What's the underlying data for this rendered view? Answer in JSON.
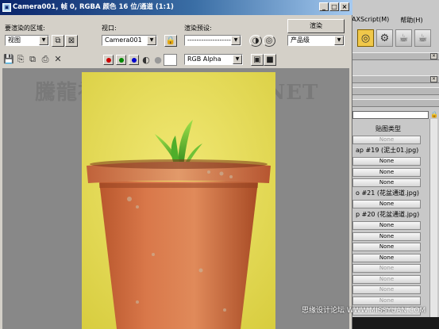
{
  "window": {
    "title": "Camera001, 帧 0, RGBA 颜色 16 位/通道 (1:1)",
    "title_icon": "render-frame-icon",
    "controls": {
      "minimize": "_",
      "maximize": "□",
      "close": "×"
    }
  },
  "toolbar": {
    "area_label": "要渲染的区域:",
    "area_value": "视图",
    "viewport_label": "视口:",
    "viewport_value": "Camera001",
    "preset_label": "渲染预设:",
    "preset_value": "-------------------",
    "render_button": "渲染",
    "mode_value": "产品级",
    "channel_value": "RGB Alpha"
  },
  "channels": {
    "red": "#cc0000",
    "green": "#008800",
    "blue": "#0000cc"
  },
  "viewport": {
    "watermark": "騰龍視覺WWW.TLV1.NET",
    "background": "#888888"
  },
  "background_app": {
    "menu": [
      "AXScript(M)",
      "帮助(H)"
    ],
    "panel_header": "贴图类型",
    "rows": [
      {
        "text": "None",
        "kind": "dim"
      },
      {
        "text": "ap #19 (泥土01.jpg)",
        "kind": "label"
      },
      {
        "text": "None",
        "kind": "btn"
      },
      {
        "text": "None",
        "kind": "btn"
      },
      {
        "text": "None",
        "kind": "btn"
      },
      {
        "text": "o #21 (花盆通道.jpg)",
        "kind": "label"
      },
      {
        "text": "None",
        "kind": "btn"
      },
      {
        "text": "p #20 (花盆通道.jpg)",
        "kind": "label"
      },
      {
        "text": "None",
        "kind": "btn"
      },
      {
        "text": "None",
        "kind": "btn"
      },
      {
        "text": "None",
        "kind": "btn"
      },
      {
        "text": "None",
        "kind": "btn"
      },
      {
        "text": "None",
        "kind": "dim"
      },
      {
        "text": "None",
        "kind": "dim"
      },
      {
        "text": "None",
        "kind": "dim"
      },
      {
        "text": "None",
        "kind": "dim"
      },
      {
        "text": "None",
        "kind": "dim"
      }
    ]
  },
  "credit": "思缘设计论坛 WWW.MISSYUAN.COM"
}
